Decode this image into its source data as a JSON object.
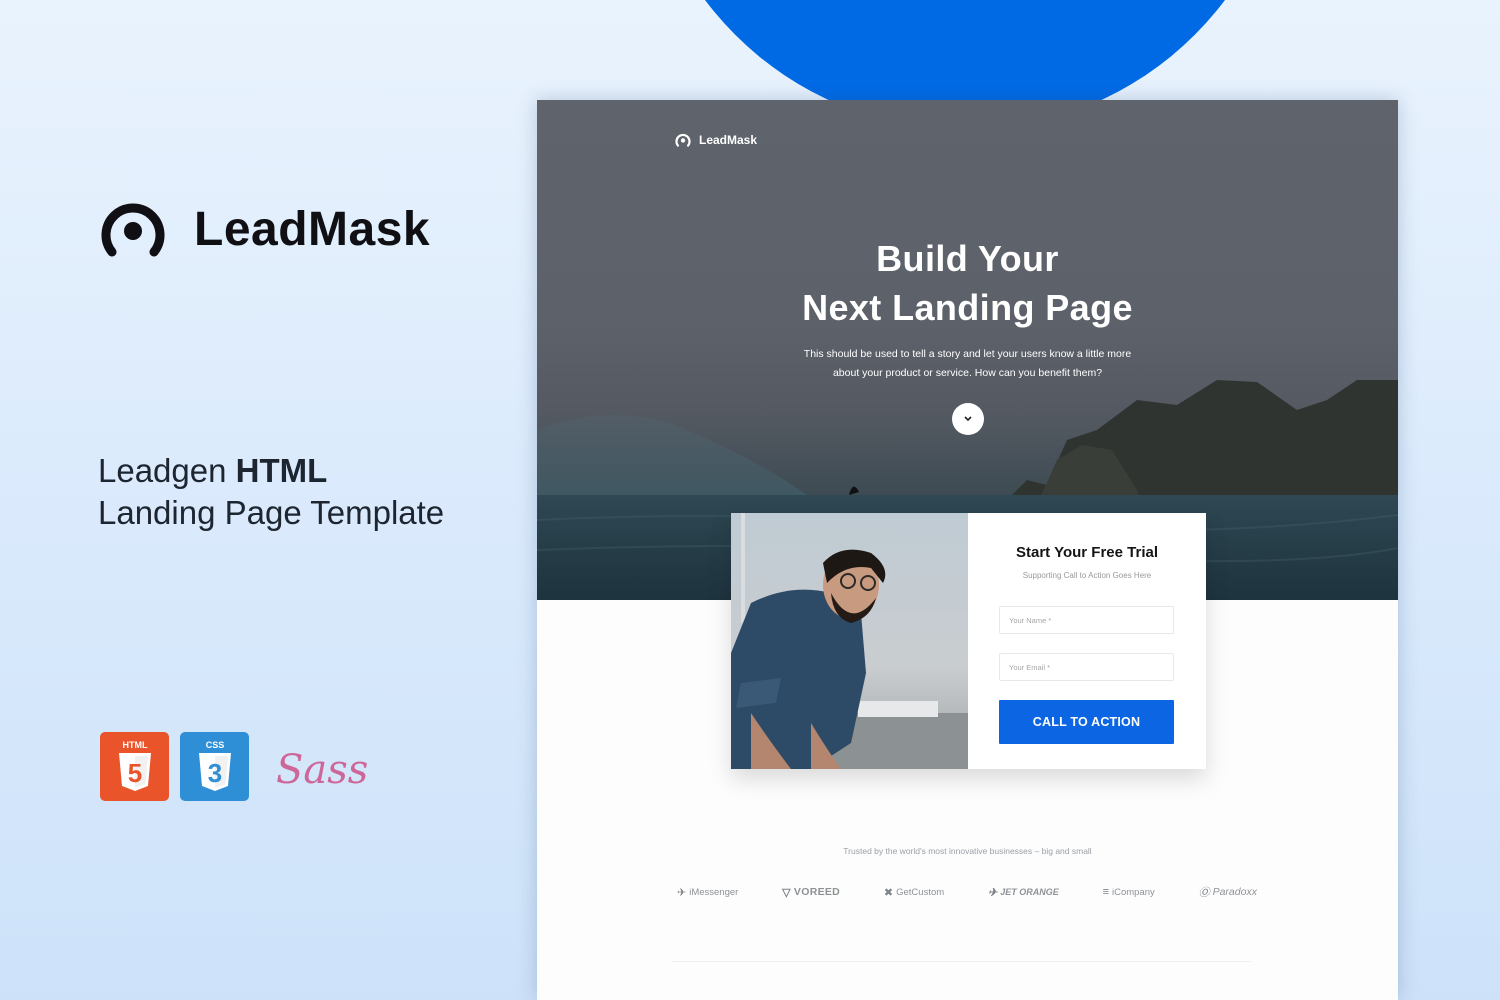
{
  "brand": {
    "name": "LeadMask",
    "tagline_light": "Leadgen",
    "tagline_bold": "HTML",
    "tagline_line2": "Landing Page Template",
    "accent_color": "#006ae5"
  },
  "tech_badges": [
    {
      "label": "HTML",
      "glyph": "5",
      "icon": "html5-icon",
      "color": "#e9542b"
    },
    {
      "label": "CSS",
      "glyph": "3",
      "icon": "css3-icon",
      "color": "#2f8fd6"
    },
    {
      "label": "Sass",
      "icon": "sass-icon",
      "color": "#cd6799"
    }
  ],
  "mockup": {
    "logo_text": "LeadMask",
    "hero": {
      "title_line1": "Build Your",
      "title_line2": "Next Landing Page",
      "subtitle_line1": "This should be used to tell a story and let your users know a little more",
      "subtitle_line2": "about your product or service. How can you benefit them?",
      "scroll_icon": "chevron-down-icon"
    },
    "form": {
      "title": "Start Your Free Trial",
      "subtitle": "Supporting Call to Action Goes Here",
      "name_placeholder": "Your Name *",
      "email_placeholder": "Your Email *",
      "cta_label": "CALL TO ACTION",
      "cta_color": "#0c66e4"
    },
    "trusted_text": "Trusted by the world's most innovative businesses – big and small",
    "clients": [
      {
        "name": "iMessenger",
        "icon": "messenger-icon"
      },
      {
        "name": "VOREED",
        "icon": "voreed-icon"
      },
      {
        "name": "GetCustom",
        "icon": "getcustom-icon"
      },
      {
        "name": "JET ORANGE",
        "icon": "jet-orange-icon"
      },
      {
        "name": "iCompany",
        "icon": "icompany-icon"
      },
      {
        "name": "Paradoxx",
        "icon": "paradoxx-icon"
      }
    ]
  }
}
